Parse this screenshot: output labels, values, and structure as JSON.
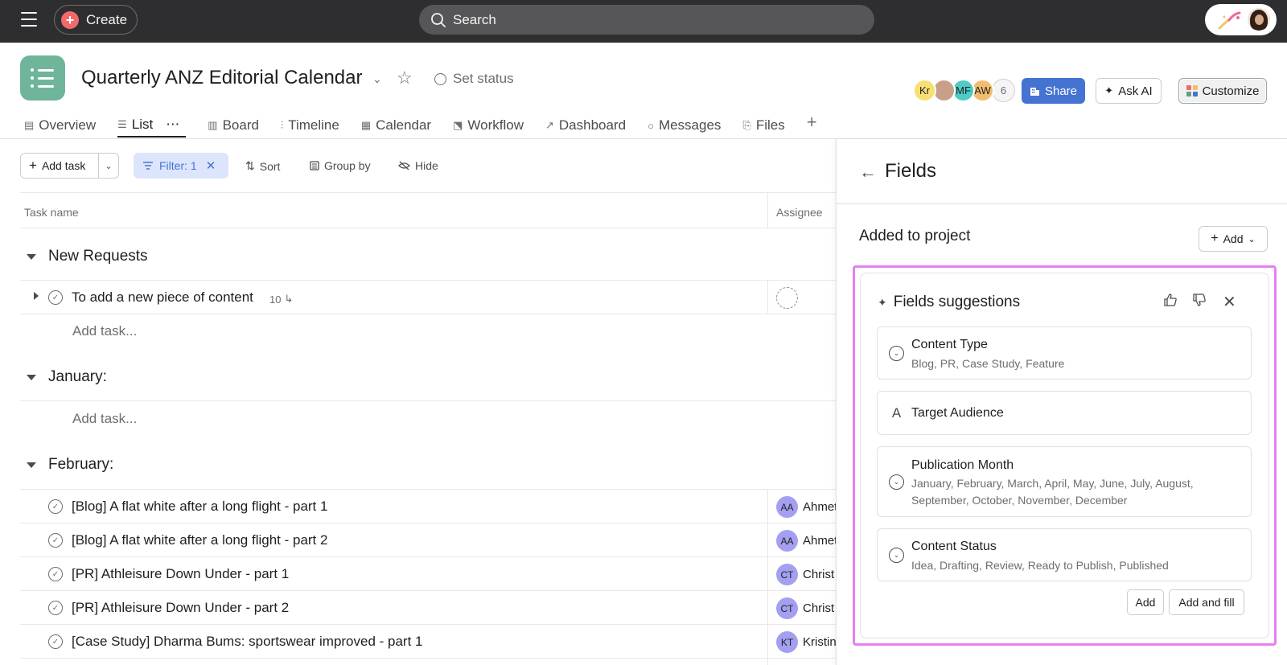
{
  "topbar": {
    "create_label": "Create",
    "search_placeholder": "Search"
  },
  "project": {
    "title": "Quarterly ANZ Editorial Calendar",
    "set_status_label": "Set status",
    "members": [
      {
        "initials": "Kr",
        "color": "#f8df72"
      },
      {
        "initials": "",
        "color": "#c8a08a"
      },
      {
        "initials": "MF",
        "color": "#4ecbc4"
      },
      {
        "initials": "AW",
        "color": "#f1bd6c"
      }
    ],
    "member_count": "6",
    "share_label": "Share",
    "ask_ai_label": "Ask AI",
    "customize_label": "Customize",
    "accent_color": "#4573d2"
  },
  "tabs": [
    {
      "label": "Overview",
      "icon": "overview-icon"
    },
    {
      "label": "List",
      "icon": "list-icon",
      "active": true
    },
    {
      "label": "Board",
      "icon": "board-icon"
    },
    {
      "label": "Timeline",
      "icon": "timeline-icon"
    },
    {
      "label": "Calendar",
      "icon": "calendar-icon"
    },
    {
      "label": "Workflow",
      "icon": "workflow-icon"
    },
    {
      "label": "Dashboard",
      "icon": "dashboard-icon"
    },
    {
      "label": "Messages",
      "icon": "messages-icon"
    },
    {
      "label": "Files",
      "icon": "files-icon"
    }
  ],
  "toolbar": {
    "add_task_label": "Add task",
    "filter_label": "Filter: 1",
    "sort_label": "Sort",
    "group_by_label": "Group by",
    "hide_label": "Hide"
  },
  "list": {
    "col_task_name": "Task name",
    "col_assignee": "Assignee",
    "add_task_placeholder": "Add task...",
    "sections": [
      {
        "name": "New Requests",
        "tasks": [
          {
            "name": "To add a new piece of content",
            "subtasks": "10",
            "assignee_initials": "",
            "assignee_name": ""
          }
        ]
      },
      {
        "name": "January:",
        "tasks": []
      },
      {
        "name": "February:",
        "tasks": [
          {
            "name": "[Blog] A flat white after a long flight - part 1",
            "assignee_initials": "AA",
            "assignee_name": "Ahmet"
          },
          {
            "name": "[Blog] A flat white after a long flight - part 2",
            "assignee_initials": "AA",
            "assignee_name": "Ahmet"
          },
          {
            "name": "[PR] Athleisure Down Under - part 1",
            "assignee_initials": "CT",
            "assignee_name": "Christ"
          },
          {
            "name": "[PR] Athleisure Down Under - part 2",
            "assignee_initials": "CT",
            "assignee_name": "Christ"
          },
          {
            "name": "[Case Study] Dharma Bums: sportswear improved - part 1",
            "assignee_initials": "KT",
            "assignee_name": "Kristin"
          }
        ]
      }
    ]
  },
  "fields_panel": {
    "title": "Fields",
    "added_to_project_label": "Added to project",
    "add_label": "Add",
    "suggestions": {
      "title": "Fields suggestions",
      "fields": [
        {
          "name": "Content Type",
          "type_icon": "single-select-icon",
          "options": "Blog, PR, Case Study, Feature"
        },
        {
          "name": "Target Audience",
          "type_icon": "text-field-icon",
          "options": ""
        },
        {
          "name": "Publication Month",
          "type_icon": "single-select-icon",
          "options": "January, February, March, April, May, June, July, August, September, October, November, December"
        },
        {
          "name": "Content Status",
          "type_icon": "single-select-icon",
          "options": "Idea, Drafting, Review, Ready to Publish, Published"
        }
      ],
      "add_button_label": "Add",
      "add_and_fill_label": "Add and fill",
      "highlight_color": "#e57ff2"
    }
  }
}
